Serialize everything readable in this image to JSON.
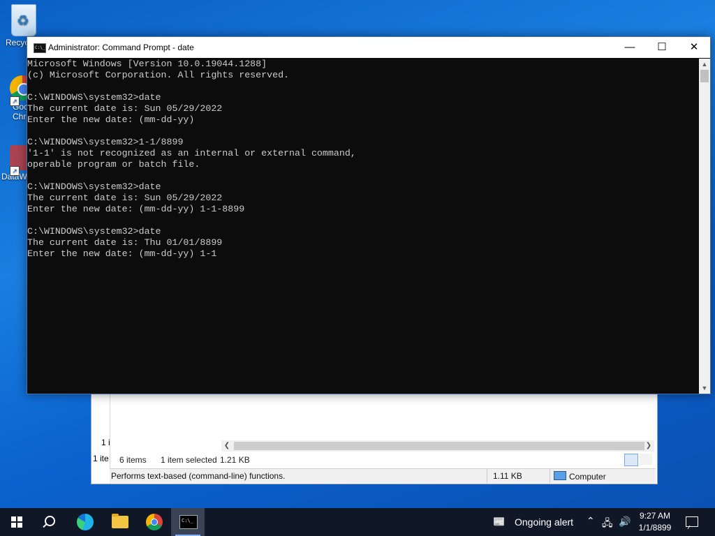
{
  "desktop": {
    "icons": [
      {
        "label": "Recyc"
      },
      {
        "label": "Goc\nChr"
      },
      {
        "label": "DataW"
      }
    ]
  },
  "cmd": {
    "title": "Administrator: Command Prompt - date",
    "controls": {
      "minimize": "—",
      "maximize": "☐",
      "close": "✕"
    },
    "lines": [
      "Microsoft Windows [Version 10.0.19044.1288]",
      "(c) Microsoft Corporation. All rights reserved.",
      "",
      "C:\\WINDOWS\\system32>date",
      "The current date is: Sun 05/29/2022",
      "Enter the new date: (mm-dd-yy)",
      "",
      "C:\\WINDOWS\\system32>1-1/8899",
      "'1-1' is not recognized as an internal or external command,",
      "operable program or batch file.",
      "",
      "C:\\WINDOWS\\system32>date",
      "The current date is: Sun 05/29/2022",
      "Enter the new date: (mm-dd-yy) 1-1-8899",
      "",
      "C:\\WINDOWS\\system32>date",
      "The current date is: Thu 01/01/8899",
      "Enter the new date: (mm-dd-yy) 1-1"
    ]
  },
  "explorer": {
    "left_fragment_1": "1 i",
    "left_fragment_2": "1 ite",
    "item_count": "6 items",
    "selected": "1 item selected",
    "selected_size": "1.21 KB",
    "description": "Performs text-based (command-line) functions.",
    "size": "1.11 KB",
    "location": "Computer"
  },
  "taskbar": {
    "alert_text": "Ongoing alert",
    "time": "9:27 AM",
    "date": "1/1/8899"
  }
}
